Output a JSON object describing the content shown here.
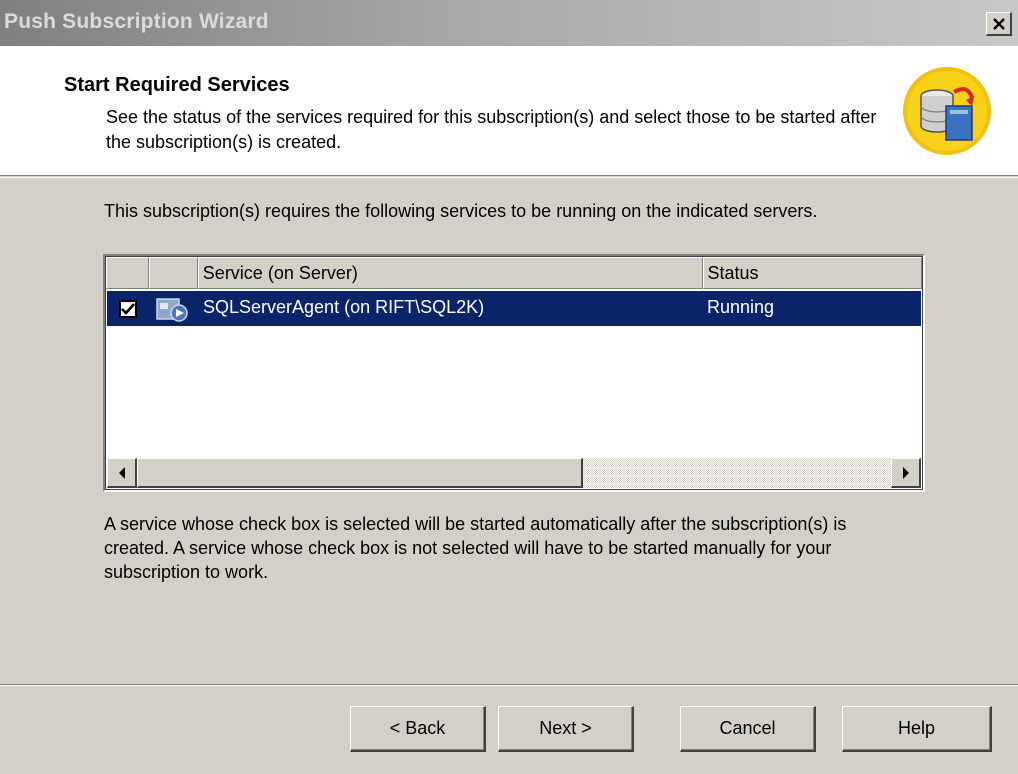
{
  "window": {
    "title": "Push Subscription Wizard"
  },
  "header": {
    "title": "Start Required Services",
    "description": "See the status of the services required for this subscription(s) and select those to be started after the subscription(s) is created."
  },
  "intro": "This subscription(s) requires the following services to be running on the indicated servers.",
  "list": {
    "columns": {
      "check": "",
      "icon": "",
      "service": "Service (on Server)",
      "status": "Status"
    },
    "rows": [
      {
        "checked": true,
        "service": "SQLServerAgent (on RIFT\\SQL2K)",
        "status": "Running",
        "icon": "service-agent-icon"
      }
    ]
  },
  "note": "A service whose check box is selected will be started automatically after the subscription(s) is created. A service whose check box is not selected will have to be started manually for your subscription to work.",
  "buttons": {
    "back": "< Back",
    "next": "Next >",
    "cancel": "Cancel",
    "help": "Help"
  },
  "colors": {
    "selection": "#0a246a",
    "dialog": "#d4d0c8"
  }
}
